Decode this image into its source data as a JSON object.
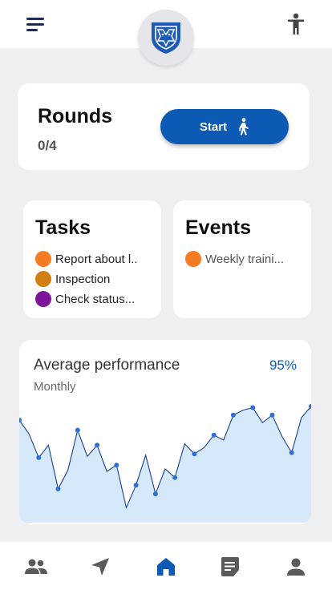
{
  "header": {
    "menu_icon": "menu-icon",
    "logo_icon": "shield-logo",
    "accessibility_icon": "accessibility-icon"
  },
  "rounds": {
    "title": "Rounds",
    "count": "0/4",
    "start_label": "Start",
    "start_icon": "walking-person-icon"
  },
  "tasks": {
    "title": "Tasks",
    "items": [
      {
        "label": "Report about l..",
        "color": "#f57c23"
      },
      {
        "label": "Inspection",
        "color": "#d17e12"
      },
      {
        "label": "Check status...",
        "color": "#7b169a"
      }
    ]
  },
  "events": {
    "title": "Events",
    "items": [
      {
        "label": "Weekly traini...",
        "color": "#f57c23"
      }
    ]
  },
  "performance": {
    "title": "Average performance",
    "subtitle": "Monthly",
    "value": "95%"
  },
  "chart_data": {
    "type": "area",
    "title": "",
    "xlabel": "",
    "ylabel": "",
    "ylim": [
      0,
      100
    ],
    "x": [
      1,
      2,
      3,
      4,
      5,
      6,
      7,
      8,
      9,
      10,
      11,
      12,
      13,
      14,
      15,
      16,
      17,
      18,
      19,
      20,
      21,
      22,
      23,
      24,
      25,
      26,
      27,
      28,
      29,
      30,
      31
    ],
    "values": [
      82,
      71,
      52,
      62,
      27,
      42,
      74,
      53,
      62,
      41,
      46,
      12,
      30,
      54,
      23,
      43,
      36,
      63,
      55,
      60,
      70,
      66,
      86,
      90,
      92,
      80,
      86,
      69,
      56,
      84,
      93
    ],
    "color": "#2f6fd6",
    "fill": "#d6e9fb"
  },
  "bottom_nav": {
    "items": [
      {
        "icon": "people-icon"
      },
      {
        "icon": "navigation-icon"
      },
      {
        "icon": "home-icon"
      },
      {
        "icon": "document-icon"
      },
      {
        "icon": "profile-icon"
      }
    ],
    "active_color": "#0d5ab5",
    "inactive_color": "#5a5a5a"
  }
}
